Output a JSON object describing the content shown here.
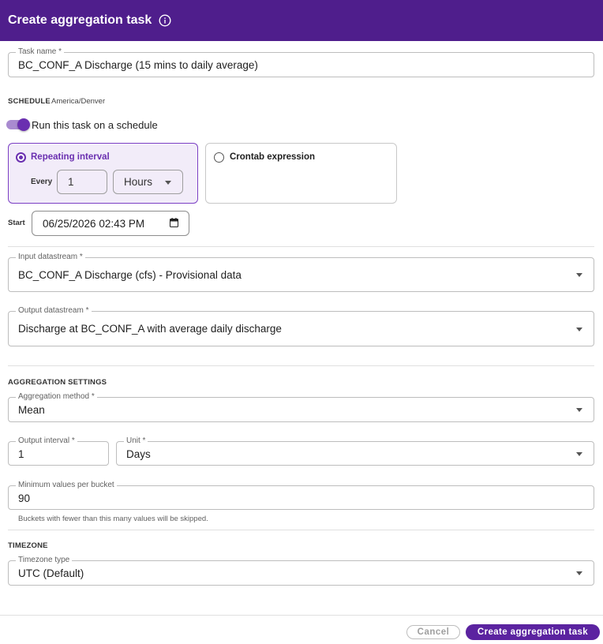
{
  "dialog": {
    "title": "Create aggregation task"
  },
  "task_name": {
    "label": "Task name *",
    "value": "BC_CONF_A Discharge (15 mins to daily average)"
  },
  "schedule": {
    "section_label": "SCHEDULE",
    "timezone_note": "America/Denver",
    "toggle_label": "Run this task on a schedule",
    "toggle_on": true,
    "repeating": {
      "title": "Repeating interval",
      "every_label": "Every",
      "every_value": "1",
      "unit_value": "Hours",
      "selected": true
    },
    "crontab": {
      "title": "Crontab expression",
      "selected": false
    },
    "start_label": "Start",
    "start_value": "06/25/2026 02:43 PM"
  },
  "datastreams": {
    "input_label": "Input datastream *",
    "input_value": "BC_CONF_A Discharge (cfs) - Provisional data",
    "output_label": "Output datastream *",
    "output_value": "Discharge at BC_CONF_A with average daily discharge"
  },
  "aggregation": {
    "section_label": "AGGREGATION SETTINGS",
    "method_label": "Aggregation method *",
    "method_value": "Mean",
    "interval_label": "Output interval *",
    "interval_value": "1",
    "unit_label": "Unit *",
    "unit_value": "Days",
    "min_values_label": "Minimum values per bucket",
    "min_values_value": "90",
    "min_values_helper": "Buckets with fewer than this many values will be skipped."
  },
  "timezone": {
    "section_label": "TIMEZONE",
    "type_label": "Timezone type",
    "type_value": "UTC (Default)"
  },
  "actions": {
    "cancel_label": "Cancel",
    "create_label": "Create aggregation task"
  },
  "colors": {
    "header_bg": "#4f1e8c",
    "accent": "#6a2fb0",
    "card_selected_bg": "#f2ecf9",
    "primary_button": "#5b23a0"
  },
  "icons": {
    "header_info": "info-icon",
    "start_picker": "calendar-icon",
    "dropdown": "chevron-down-icon"
  }
}
